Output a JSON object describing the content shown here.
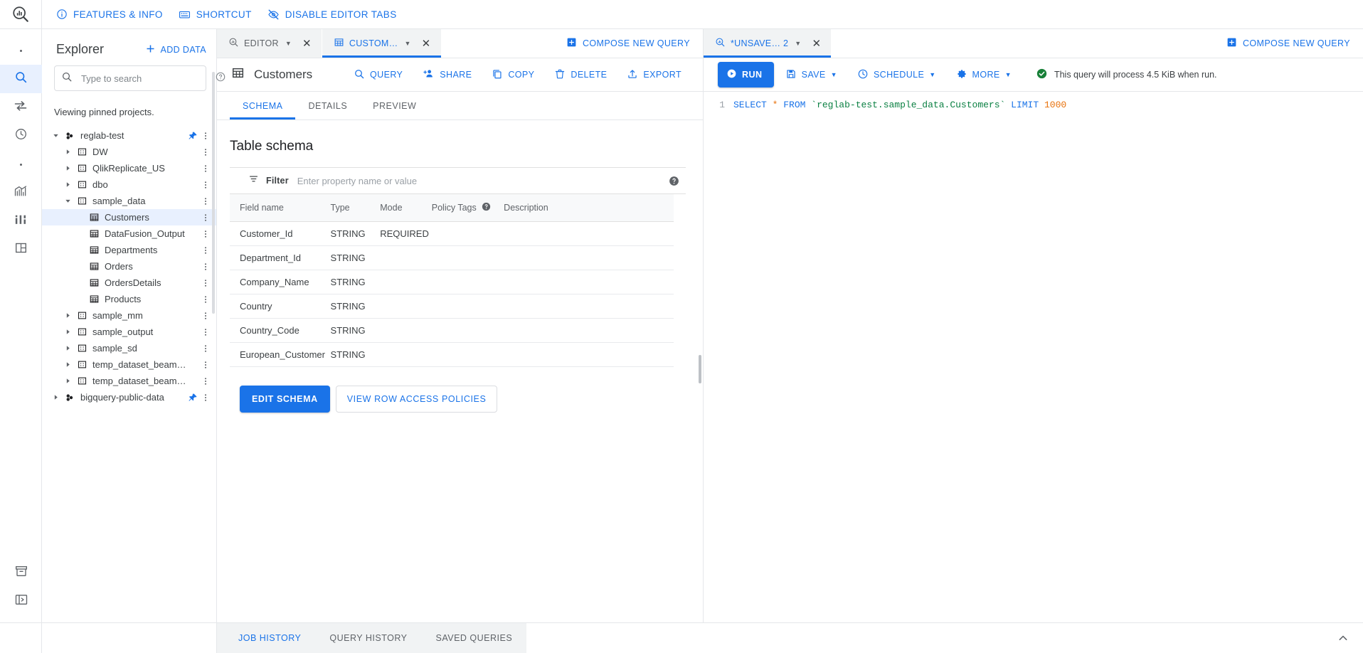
{
  "topbar": {
    "logo_icon": "bigquery-logo-icon",
    "links": [
      {
        "icon": "info-icon",
        "label": "FEATURES & INFO"
      },
      {
        "icon": "keyboard-icon",
        "label": "SHORTCUT"
      },
      {
        "icon": "eye-off-icon",
        "label": "DISABLE EDITOR TABS"
      }
    ]
  },
  "rail": {
    "items": [
      {
        "icon": "dot-icon",
        "selected": false
      },
      {
        "icon": "search-icon",
        "selected": true
      },
      {
        "icon": "transfer-icon",
        "selected": false
      },
      {
        "icon": "clock-icon",
        "selected": false
      },
      {
        "icon": "dot-icon",
        "selected": false
      },
      {
        "icon": "analytics-icon",
        "selected": false
      },
      {
        "icon": "bi-engine-icon",
        "selected": false
      },
      {
        "icon": "dataset-icon",
        "selected": false
      }
    ],
    "bottom": [
      {
        "icon": "archive-icon"
      },
      {
        "icon": "expand-panel-icon"
      }
    ]
  },
  "explorer": {
    "title": "Explorer",
    "add_data_label": "ADD DATA",
    "add_data_icon": "plus-icon",
    "search_placeholder": "Type to search",
    "search_value": "",
    "search_icon": "search-icon",
    "search_help_icon": "help-icon",
    "pinned_note": "Viewing pinned projects.",
    "tree": [
      {
        "label": "reglab-test",
        "level": 0,
        "icon": "project-icon",
        "twist": "down",
        "pinned": true,
        "menu": true,
        "selected": false
      },
      {
        "label": "DW",
        "level": 1,
        "icon": "dataset-icon",
        "twist": "right",
        "pinned": false,
        "menu": true,
        "selected": false
      },
      {
        "label": "QlikReplicate_US",
        "level": 1,
        "icon": "dataset-icon",
        "twist": "right",
        "pinned": false,
        "menu": true,
        "selected": false
      },
      {
        "label": "dbo",
        "level": 1,
        "icon": "dataset-icon",
        "twist": "right",
        "pinned": false,
        "menu": true,
        "selected": false
      },
      {
        "label": "sample_data",
        "level": 1,
        "icon": "dataset-icon",
        "twist": "down",
        "pinned": false,
        "menu": true,
        "selected": false
      },
      {
        "label": "Customers",
        "level": 2,
        "icon": "table-icon",
        "twist": "none",
        "pinned": false,
        "menu": true,
        "selected": true
      },
      {
        "label": "DataFusion_Output",
        "level": 2,
        "icon": "table-icon",
        "twist": "none",
        "pinned": false,
        "menu": true,
        "selected": false
      },
      {
        "label": "Departments",
        "level": 2,
        "icon": "table-icon",
        "twist": "none",
        "pinned": false,
        "menu": true,
        "selected": false
      },
      {
        "label": "Orders",
        "level": 2,
        "icon": "table-icon",
        "twist": "none",
        "pinned": false,
        "menu": true,
        "selected": false
      },
      {
        "label": "OrdersDetails",
        "level": 2,
        "icon": "table-icon",
        "twist": "none",
        "pinned": false,
        "menu": true,
        "selected": false
      },
      {
        "label": "Products",
        "level": 2,
        "icon": "table-icon",
        "twist": "none",
        "pinned": false,
        "menu": true,
        "selected": false
      },
      {
        "label": "sample_mm",
        "level": 1,
        "icon": "dataset-icon",
        "twist": "right",
        "pinned": false,
        "menu": true,
        "selected": false
      },
      {
        "label": "sample_output",
        "level": 1,
        "icon": "dataset-icon",
        "twist": "right",
        "pinned": false,
        "menu": true,
        "selected": false
      },
      {
        "label": "sample_sd",
        "level": 1,
        "icon": "dataset-icon",
        "twist": "right",
        "pinned": false,
        "menu": true,
        "selected": false
      },
      {
        "label": "temp_dataset_beam_bq_job_…",
        "level": 1,
        "icon": "dataset-icon",
        "twist": "right",
        "pinned": false,
        "menu": true,
        "selected": false
      },
      {
        "label": "temp_dataset_beam_bq_job_…",
        "level": 1,
        "icon": "dataset-icon",
        "twist": "right",
        "pinned": false,
        "menu": true,
        "selected": false
      },
      {
        "label": "bigquery-public-data",
        "level": 0,
        "icon": "project-icon",
        "twist": "right",
        "pinned": true,
        "menu": true,
        "selected": false
      }
    ]
  },
  "editor_tabs": {
    "left": [
      {
        "label": "EDITOR",
        "icon": "bigquery-logo-icon",
        "active": false,
        "caret": true,
        "close": true
      },
      {
        "label": "CUSTOM…",
        "icon": "table-icon",
        "active": true,
        "caret": true,
        "close": true
      }
    ],
    "compose_label": "COMPOSE NEW QUERY",
    "compose_icon": "plus-box-icon",
    "right": [
      {
        "label": "*UNSAVE…  2",
        "icon": "bigquery-logo-icon",
        "active": true,
        "caret": true,
        "close": true
      }
    ],
    "compose_right_label": "COMPOSE NEW QUERY",
    "compose_right_icon": "plus-box-icon"
  },
  "details": {
    "table_icon": "table-icon",
    "title": "Customers",
    "actions": [
      {
        "icon": "search-icon",
        "label": "QUERY"
      },
      {
        "icon": "person-add-icon",
        "label": "SHARE"
      },
      {
        "icon": "copy-icon",
        "label": "COPY"
      },
      {
        "icon": "trash-icon",
        "label": "DELETE"
      },
      {
        "icon": "export-icon",
        "label": "EXPORT"
      }
    ],
    "subtabs": [
      {
        "label": "SCHEMA",
        "active": true
      },
      {
        "label": "DETAILS",
        "active": false
      },
      {
        "label": "PREVIEW",
        "active": false
      }
    ],
    "schema_heading": "Table schema",
    "filter": {
      "icon": "filter-icon",
      "label": "Filter",
      "placeholder": "Enter property name or value",
      "value": "",
      "help_icon": "help-icon"
    },
    "columns": [
      "Field name",
      "Type",
      "Mode",
      "Policy Tags",
      "Description"
    ],
    "policy_help_icon": "help-icon",
    "rows": [
      {
        "field": "Customer_Id",
        "type": "STRING",
        "mode": "REQUIRED",
        "policy": "",
        "description": ""
      },
      {
        "field": "Department_Id",
        "type": "STRING",
        "mode": "",
        "policy": "",
        "description": ""
      },
      {
        "field": "Company_Name",
        "type": "STRING",
        "mode": "",
        "policy": "",
        "description": ""
      },
      {
        "field": "Country",
        "type": "STRING",
        "mode": "",
        "policy": "",
        "description": ""
      },
      {
        "field": "Country_Code",
        "type": "STRING",
        "mode": "",
        "policy": "",
        "description": ""
      },
      {
        "field": "European_Customer",
        "type": "STRING",
        "mode": "",
        "policy": "",
        "description": ""
      }
    ],
    "edit_schema_label": "EDIT SCHEMA",
    "view_policies_label": "VIEW ROW ACCESS POLICIES"
  },
  "query": {
    "run_label": "RUN",
    "run_icon": "play-icon",
    "actions": [
      {
        "icon": "save-icon",
        "label": "SAVE",
        "caret": true
      },
      {
        "icon": "clock-icon",
        "label": "SCHEDULE",
        "caret": true
      },
      {
        "icon": "gear-icon",
        "label": "MORE",
        "caret": true
      }
    ],
    "status_icon": "check-circle-icon",
    "status_text": "This query will process 4.5 KiB when run.",
    "line_number": "1",
    "sql_tokens": [
      {
        "t": "SELECT",
        "c": "kw"
      },
      {
        "t": " ",
        "c": "plain"
      },
      {
        "t": "*",
        "c": "op"
      },
      {
        "t": " ",
        "c": "plain"
      },
      {
        "t": "FROM",
        "c": "kw"
      },
      {
        "t": " ",
        "c": "plain"
      },
      {
        "t": "`reglab-test.sample_data.Customers`",
        "c": "str"
      },
      {
        "t": " ",
        "c": "plain"
      },
      {
        "t": "LIMIT",
        "c": "kw"
      },
      {
        "t": " ",
        "c": "plain"
      },
      {
        "t": "1000",
        "c": "num"
      }
    ]
  },
  "bottom": {
    "tabs": [
      {
        "label": "JOB HISTORY",
        "active": true
      },
      {
        "label": "QUERY HISTORY",
        "active": false
      },
      {
        "label": "SAVED QUERIES",
        "active": false
      }
    ],
    "chevron_icon": "chevron-up-icon"
  },
  "colors": {
    "accent": "#1a73e8",
    "selected_bg": "#e8f0fe",
    "tab_bg": "#f1f3f4",
    "text": "#3c4043",
    "muted": "#5f6368",
    "success": "#188038",
    "string": "#0b8043",
    "number": "#e8710a"
  }
}
